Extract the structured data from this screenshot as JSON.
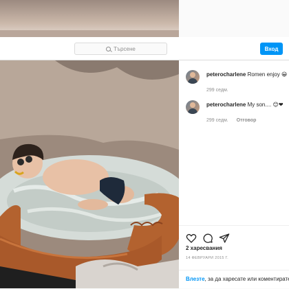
{
  "header": {
    "search_placeholder": "Търсене",
    "login_button": "Вход"
  },
  "comments": [
    {
      "username": "peterocharlene",
      "text": "Romen enjoy 😀",
      "time": "299 седм.",
      "reply": ""
    },
    {
      "username": "peterocharlene",
      "text": "My son.... 😊❤",
      "time": "299 седм.",
      "reply": "Отговор"
    }
  ],
  "post": {
    "likes": "2 харесвания",
    "date": "14 ФЕВРУАРИ 2015 Г."
  },
  "login_prompt": {
    "link": "Влезте",
    "text": ", за да харесате или коментирате."
  },
  "colors": {
    "accent": "#0095f6",
    "tub_brown": "#b3622f",
    "water": "#cfd8d4"
  }
}
